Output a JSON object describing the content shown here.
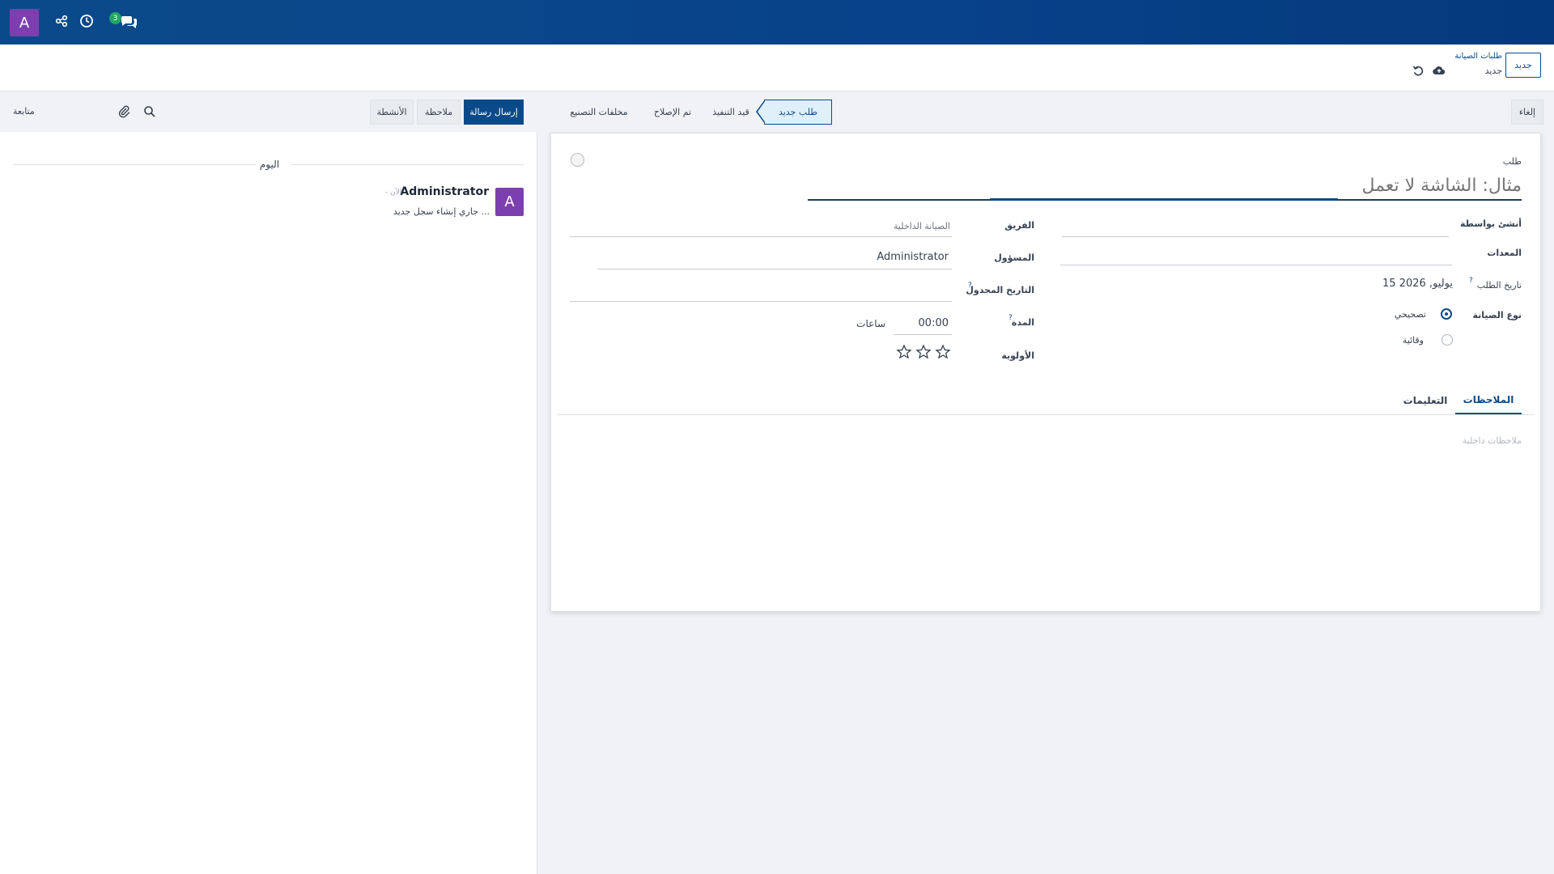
{
  "navbar": {
    "avatar_letter": "A",
    "icons": [
      "share-nodes-icon",
      "clock-icon",
      "chat-bubbles-icon"
    ],
    "messages_badge": "3",
    "accent_color": "#0b4a8a"
  },
  "control": {
    "new_button": "جديد",
    "breadcrumb_parent": "طلبات الصيانة",
    "breadcrumb_current": "جديد",
    "icons": [
      "cloud-upload-icon",
      "undo-icon"
    ]
  },
  "statusbar": {
    "cancel_label": "إلغاء",
    "stages": [
      "طلب جديد",
      "قيد التنفيذ",
      "تم الإصلاح",
      "مخلفات التصنيع"
    ],
    "active_stage": "طلب جديد"
  },
  "form": {
    "request_label": "طلب",
    "name_placeholder": "مثال: الشاشة لا تعمل",
    "created_by_label": "أنشئ بواسطة",
    "equipment_label": "المعدات",
    "request_date_label": "تاريخ الطلب",
    "request_date_value": "15 يوليو, 2026",
    "maintenance_type_label": "نوع الصيانة",
    "type_corrective": "تصحيحي",
    "type_preventive": "وقائية",
    "team_label": "الفريق",
    "team_value": "الصيانة الداخلية",
    "responsible_label": "المسؤول",
    "responsible_value": "Administrator",
    "scheduled_date_label": "التاريخ المجدول",
    "duration_label": "المدة",
    "duration_value": "00:00",
    "duration_unit": "ساعات",
    "priority_label": "الأولوية",
    "priority_stars": 0,
    "help_mark": "?"
  },
  "tabs": {
    "notes": "الملاحظات",
    "instructions": "التعليمات",
    "notes_placeholder": "ملاحظات داخلية"
  },
  "chatter": {
    "send_message": "إرسال رسالة",
    "log_note": "ملاحظة",
    "activities": "الأنشطة",
    "follow": "متابعة",
    "date_separator": "اليوم",
    "message": {
      "avatar_letter": "A",
      "author": "Administrator",
      "time": "- الآن",
      "body": "جاري إنشاء سجل جديد ..."
    }
  }
}
